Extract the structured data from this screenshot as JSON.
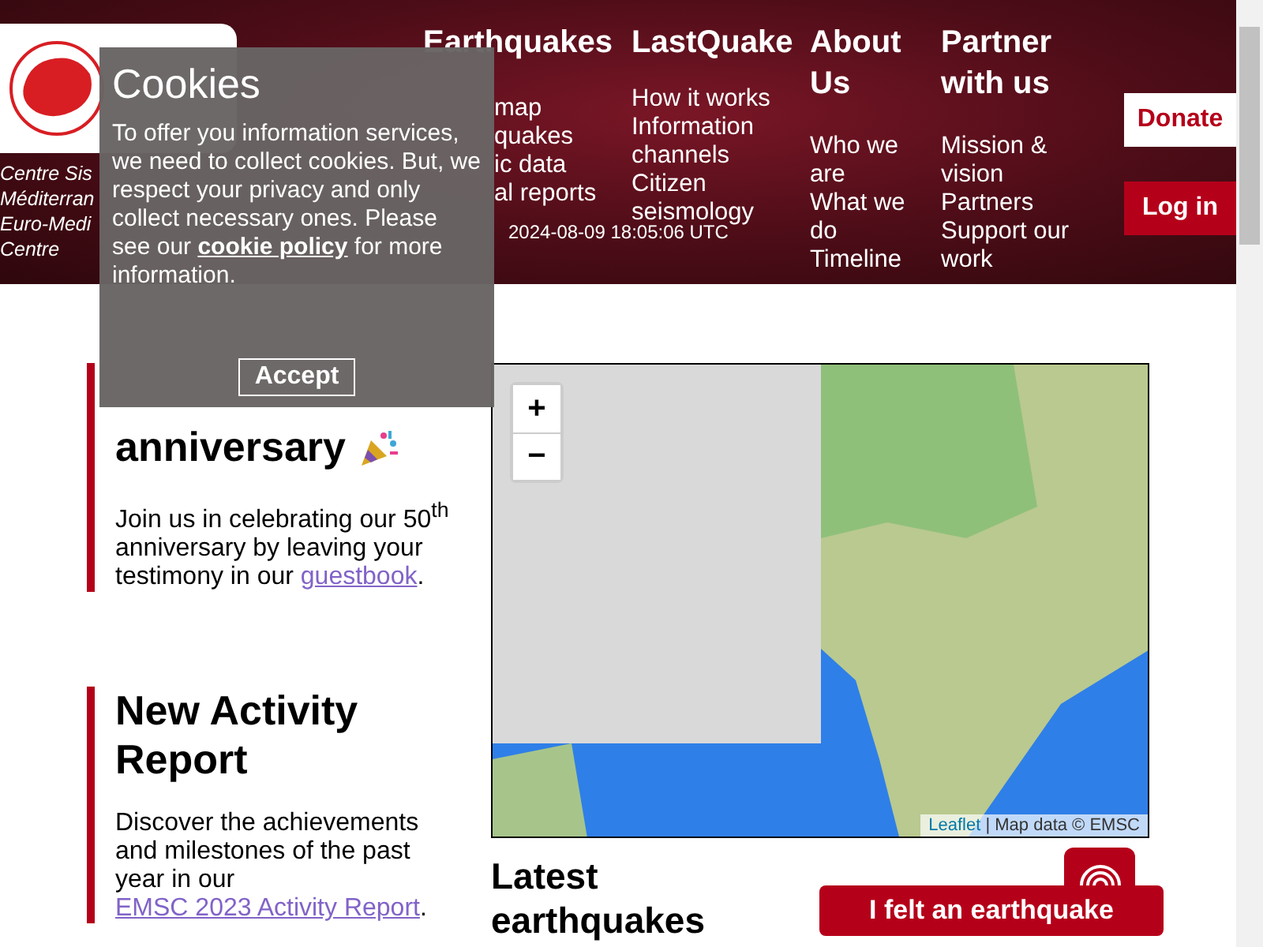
{
  "header": {
    "logo_subtitle": [
      "Centre Sis",
      "Méditerran",
      "Euro-Medi",
      "Centre"
    ],
    "nav": [
      {
        "title": "Earthquakes",
        "items": [
          "map",
          "quakes",
          "ic data",
          "al reports"
        ]
      },
      {
        "title": "LastQuake",
        "items": [
          "How it works",
          "Information channels",
          "Citizen seismology"
        ]
      },
      {
        "title": "About Us",
        "items": [
          "Who we are",
          "What we do",
          "Timeline"
        ]
      },
      {
        "title": "Partner with us",
        "items": [
          "Mission & vision",
          "Partners",
          "Support our work"
        ]
      }
    ],
    "timestamp": "2024-08-09 18:05:06 UTC",
    "buttons": [
      {
        "label": "Donate",
        "kind": "outline"
      },
      {
        "label": "Log in",
        "kind": "solid"
      }
    ]
  },
  "cookie_banner": {
    "title": "Cookies",
    "text_before": "To offer you information services, we need to collect cookies. But, we respect your privacy and only collect necessary ones. Please see our ",
    "link": "cookie policy",
    "text_after": " for more information.",
    "button": "Accept"
  },
  "cards": [
    {
      "title": "anniversary",
      "party_icon": true,
      "text": "Join us in celebrating our 50$^{th}$ anniversary by leaving your testimony in our ",
      "link": "guestbook",
      "text_after": "."
    },
    {
      "title": "New Activity Report",
      "party_icon": false,
      "text": "Discover the achievements and milestones of the past year in our ",
      "link": "EMSC 2023 Activity Report",
      "text_after": "."
    }
  ],
  "map": {
    "zoom_in": "+",
    "zoom_out": "−",
    "attribution_link": "Leaflet",
    "attribution": "| Map data © EMSC"
  },
  "latest": {
    "heading": "Latest earthquakes"
  },
  "felt_button": "I felt an earthquake"
}
